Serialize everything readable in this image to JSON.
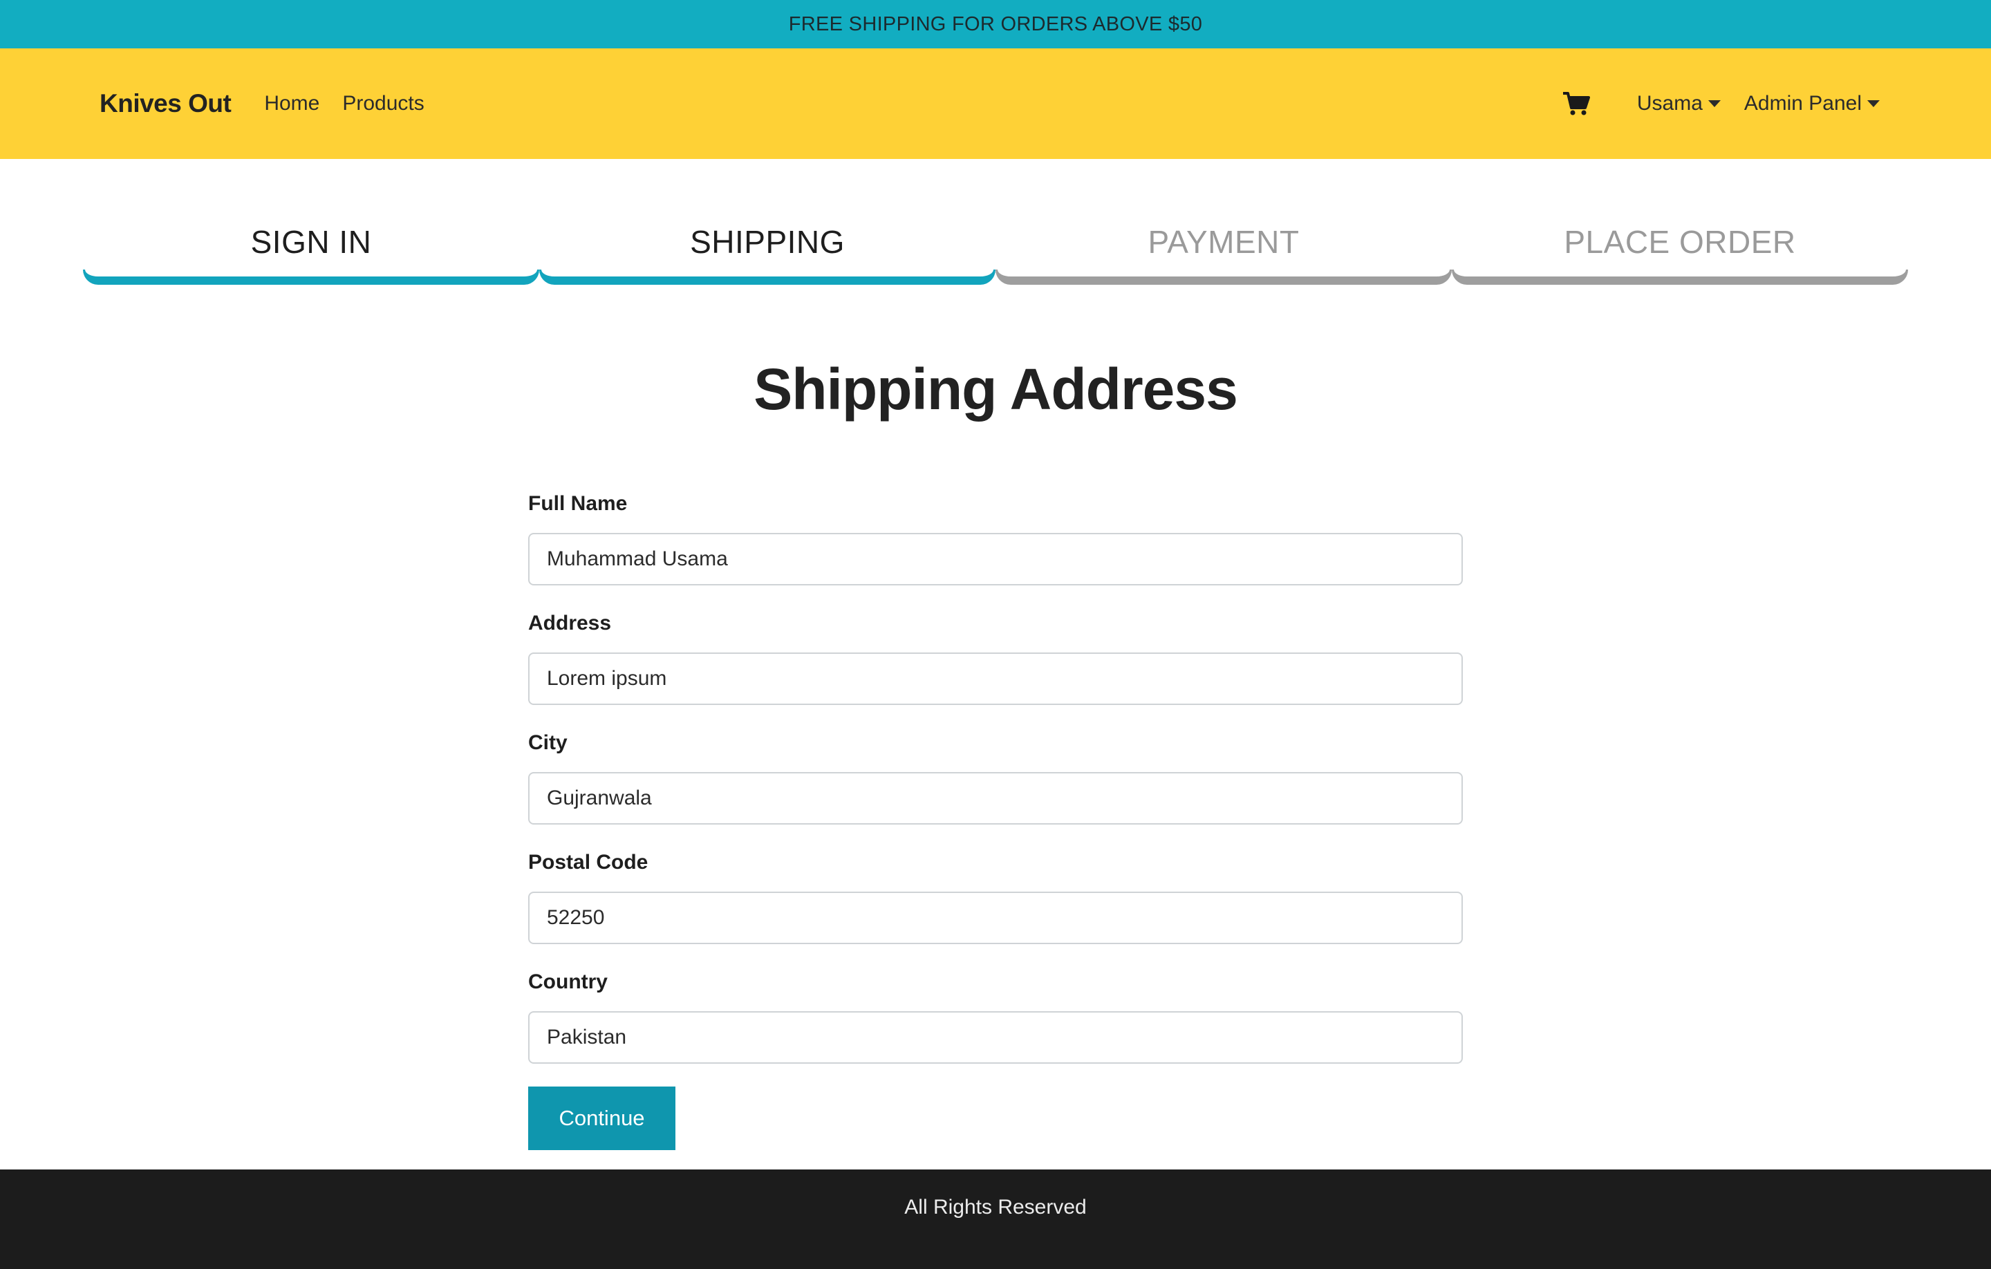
{
  "promo": {
    "text": "FREE SHIPPING FOR ORDERS ABOVE $50"
  },
  "navbar": {
    "brand": "Knives Out",
    "links": [
      {
        "label": "Home"
      },
      {
        "label": "Products"
      }
    ],
    "cart_icon": "shopping-cart-icon",
    "user_menu": "Usama",
    "admin_menu": "Admin Panel"
  },
  "steps": [
    {
      "label": "SIGN IN",
      "state": "active"
    },
    {
      "label": "SHIPPING",
      "state": "active"
    },
    {
      "label": "PAYMENT",
      "state": "disabled"
    },
    {
      "label": "PLACE ORDER",
      "state": "disabled"
    }
  ],
  "form": {
    "title": "Shipping Address",
    "fields": [
      {
        "label": "Full Name",
        "value": "Muhammad Usama"
      },
      {
        "label": "Address",
        "value": "Lorem ipsum"
      },
      {
        "label": "City",
        "value": "Gujranwala"
      },
      {
        "label": "Postal Code",
        "value": "52250"
      },
      {
        "label": "Country",
        "value": "Pakistan"
      }
    ],
    "submit_label": "Continue"
  },
  "footer": {
    "text": "All Rights Reserved"
  },
  "colors": {
    "promo_bg": "#12adc1",
    "navbar_bg": "#fed136",
    "step_active": "#12a4bd",
    "step_disabled": "#9e9e9e",
    "button_bg": "#0f96ae",
    "footer_bg": "#1c1c1c"
  }
}
